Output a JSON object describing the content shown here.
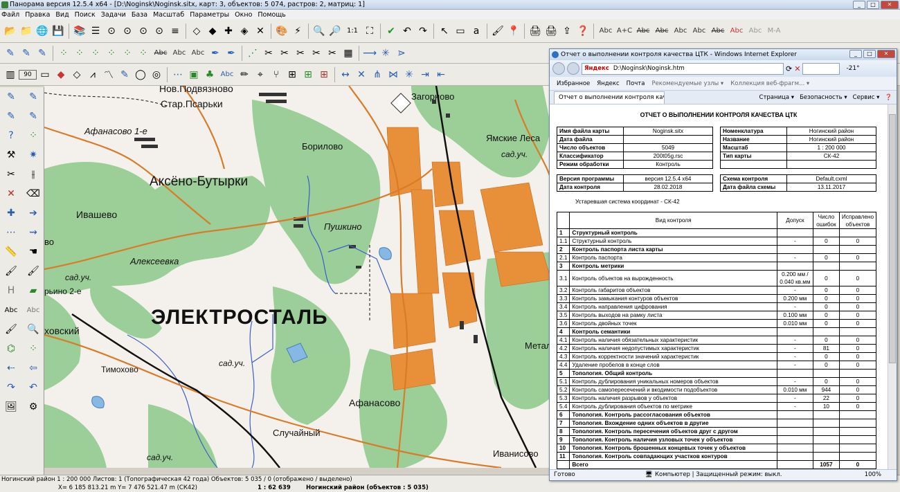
{
  "app": {
    "title": "Панорама версия 12.5.4 x64 - [D:\\Noginsk\\Noginsk.sitx, карт: 3, объектов: 5 074, растров: 2, матриц: 1]"
  },
  "menu": [
    "Файл",
    "Правка",
    "Вид",
    "Поиск",
    "Задачи",
    "База",
    "Масштаб",
    "Параметры",
    "Окно",
    "Помощь"
  ],
  "toolbar": {
    "zoom_label": "1:1",
    "text_tools": [
      "Abc",
      "A+C",
      "Abc",
      "Abc",
      "Abc",
      "Abc",
      "Abc",
      "Abc",
      "Abc",
      "M-A"
    ],
    "row2_text": [
      "Abc",
      "Abc",
      "Abc"
    ],
    "row3_text": "Abc",
    "row3_badge": "90"
  },
  "map": {
    "labels": {
      "nov_podvyaznovo": "Нов.Подвязново",
      "star_psarki": "Стар.Псарьки",
      "afanasovo1": "Афанасово 1-е",
      "borilovo": "Борилово",
      "aksyono": "Аксёно-Бутырки",
      "ivashevo": "Ивашево",
      "pushkino": "Пушкино",
      "alekseevka": "Алексеевка",
      "sad1": "сад.уч.",
      "rino2": "рьино 2-е",
      "vo": "во",
      "elektrostal": "ЭЛЕКТРОСТАЛЬ",
      "khovskiy": "ховский",
      "timokhovo": "Тимохово",
      "sad2": "сад.уч.",
      "afanasovo": "Афанасово",
      "sluchainy": "Случайный",
      "sad3": "сад.уч.",
      "zagornovo": "Загорново",
      "yamskie": "Ямские Леса",
      "sad4": "сад.уч.",
      "ivanisovo": "Иванисово",
      "metal": "Метал"
    }
  },
  "status": {
    "line1": "Ногинский район  1 : 200 000   Листов: 1   (Топографическая 42 года)   Объектов: 5 035 / 0 (отображено / выделено)",
    "coords": "X= 6 185 813.21 m    Y= 7 476 521.47 m   (СК42)",
    "scale": "1 : 62 639",
    "region": "Ногинский район  (объектов : 5 035)"
  },
  "ie": {
    "title": "Отчет о выполнении контроля качества ЦТК - Windows Internet Explorer",
    "brand": "Яндекс",
    "address": "D:\\Noginsk\\Noginsk.htm",
    "weather": "-21°",
    "favorites": [
      "Избранное",
      "Яндекс",
      "Почта",
      "Рекомендуемые узлы ▾",
      "Коллекция веб-фрагм... ▾"
    ],
    "tab": "Отчет о выполнении контроля качест...",
    "commands": [
      "Страница ▾",
      "Безопасность ▾",
      "Сервис ▾"
    ],
    "status_left": "Готово",
    "status_mid": "Компьютер | Защищенный режим: выкл.",
    "zoom": "100%"
  },
  "report": {
    "heading": "ОТЧЕТ О ВЫПОЛНЕНИИ КОНТРОЛЯ КАЧЕСТВА ЦТК",
    "left": [
      [
        "Имя файла карты",
        "Noginsk.sitx"
      ],
      [
        "Дата файла",
        ""
      ],
      [
        "Число объектов",
        "5049"
      ],
      [
        "Классификатор",
        "200t05g.rsc"
      ],
      [
        "Режим обработки",
        "Контроль"
      ]
    ],
    "right": [
      [
        "Номенклатура",
        "Ногинский район"
      ],
      [
        "Название",
        "Ногинский район"
      ],
      [
        "Масштаб",
        "1 : 200 000"
      ],
      [
        "Тип карты",
        "СК-42"
      ]
    ],
    "left2": [
      [
        "Версия программы",
        "версия 12.5.4 x64"
      ],
      [
        "Дата контроля",
        "28.02.2018"
      ]
    ],
    "right2": [
      [
        "Схема контроля",
        "Default.cxml"
      ],
      [
        "Дата файла схемы",
        "13.11.2017"
      ]
    ],
    "coord_system": "Устаревшая система координат - СК-42",
    "headers": [
      "Вид контроля",
      "Допуск",
      "Число ошибок",
      "Исправлено объектов"
    ],
    "rows": [
      [
        "1",
        "Структурный контроль",
        "",
        "",
        ""
      ],
      [
        "1.1",
        "Структурный контроль",
        "-",
        "0",
        "0"
      ],
      [
        "2",
        "Контроль паспорта листа карты",
        "",
        "",
        ""
      ],
      [
        "2.1",
        "Контроль паспорта",
        "-",
        "0",
        "0"
      ],
      [
        "3",
        "Контроль метрики",
        "",
        "",
        ""
      ],
      [
        "3.1",
        "Контроль объектов на вырожденность",
        "0.200 мм / 0.040 кв.мм",
        "0",
        "0"
      ],
      [
        "3.2",
        "Контроль габаритов объектов",
        "-",
        "0",
        "0"
      ],
      [
        "3.3",
        "Контроль замыкания контуров объектов",
        "0.200 мм",
        "0",
        "0"
      ],
      [
        "3.4",
        "Контроль направления цифрования",
        "-",
        "0",
        "0"
      ],
      [
        "3.5",
        "Контроль выходов на рамку листа",
        "0.100 мм",
        "0",
        "0"
      ],
      [
        "3.6",
        "Контроль двойных точек",
        "0.010 мм",
        "0",
        "0"
      ],
      [
        "4",
        "Контроль семантики",
        "",
        "",
        ""
      ],
      [
        "4.1",
        "Контроль наличия обязательных характеристик",
        "-",
        "0",
        "0"
      ],
      [
        "4.2",
        "Контроль наличия недопустимых характеристик",
        "-",
        "81",
        "0"
      ],
      [
        "4.3",
        "Контроль корректности значений характеристик",
        "-",
        "0",
        "0"
      ],
      [
        "4.4",
        "Удаление пробелов в конце слов",
        "-",
        "0",
        "0"
      ],
      [
        "5",
        "Топология. Общий контроль",
        "",
        "",
        ""
      ],
      [
        "5.1",
        "Контроль дублирования уникальных номеров объектов",
        "-",
        "0",
        "0"
      ],
      [
        "5.2",
        "Контроль самопересечений и вкодимости подобъектов",
        "0.010 мм",
        "944",
        "0"
      ],
      [
        "5.3",
        "Контроль наличия разрывов у объектов",
        "-",
        "22",
        "0"
      ],
      [
        "5.4",
        "Контроль дублирования объектов по метрике",
        "-",
        "10",
        "0"
      ],
      [
        "6",
        "Топология. Контроль рассогласования объектов",
        "",
        "",
        ""
      ],
      [
        "7",
        "Топология. Вхождение одних объектов в другие",
        "",
        "",
        ""
      ],
      [
        "8",
        "Топология. Контроль пересечения объектов друг с другом",
        "",
        "",
        ""
      ],
      [
        "9",
        "Топология. Контроль наличия узловых точек у объектов",
        "",
        "",
        ""
      ],
      [
        "10",
        "Топология. Контроль брошенных концевых точек у объектов",
        "",
        "",
        ""
      ],
      [
        "11",
        "Топология. Контроль совпадающих участков контуров",
        "",
        "",
        ""
      ],
      [
        "",
        "Всего",
        "",
        "1057",
        "0"
      ]
    ]
  }
}
